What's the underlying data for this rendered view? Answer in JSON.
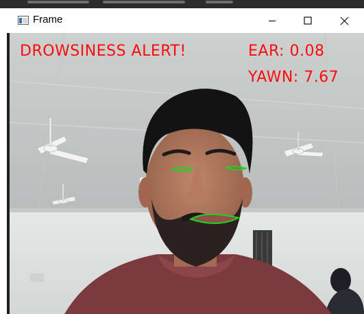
{
  "window": {
    "title": "Frame",
    "controls": {
      "minimize": "minimize-icon",
      "maximize": "maximize-icon",
      "close": "close-icon"
    }
  },
  "overlay": {
    "alert": "DROWSINESS ALERT!",
    "ear": "EAR: 0.08",
    "yawn": "YAWN: 7.67",
    "text_color": "#ff0a0a",
    "contour_color": "#22d11f"
  }
}
